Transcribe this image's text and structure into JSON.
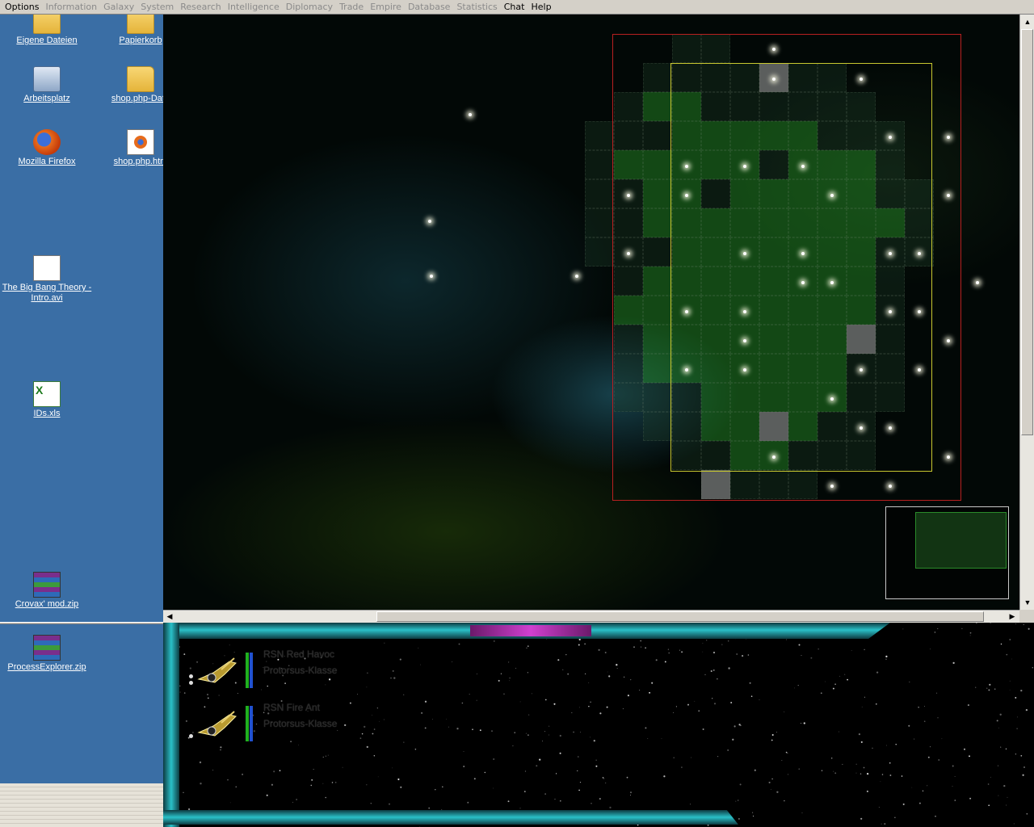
{
  "menu": {
    "items": [
      {
        "label": "Options",
        "enabled": true
      },
      {
        "label": "Information",
        "enabled": false
      },
      {
        "label": "Galaxy",
        "enabled": false
      },
      {
        "label": "System",
        "enabled": false
      },
      {
        "label": "Research",
        "enabled": false
      },
      {
        "label": "Intelligence",
        "enabled": false
      },
      {
        "label": "Diplomacy",
        "enabled": false
      },
      {
        "label": "Trade",
        "enabled": false
      },
      {
        "label": "Empire",
        "enabled": false
      },
      {
        "label": "Database",
        "enabled": false
      },
      {
        "label": "Statistics",
        "enabled": false
      },
      {
        "label": "Chat",
        "enabled": true
      },
      {
        "label": "Help",
        "enabled": true
      }
    ]
  },
  "desktop": {
    "icons": [
      {
        "label": "Eigene Dateien",
        "icon": "folder-icon"
      },
      {
        "label": "Papierkorb",
        "icon": "recycle-bin-icon"
      },
      {
        "label": "Arbeitsplatz",
        "icon": "computer-icon"
      },
      {
        "label": "shop.php-Date",
        "icon": "folder-icon"
      },
      {
        "label": "Mozilla Firefox",
        "icon": "firefox-icon"
      },
      {
        "label": "shop.php.htm",
        "icon": "firefox-document-icon"
      },
      {
        "label": "The Big Bang Theory - Intro.avi",
        "icon": "video-file-icon"
      },
      {
        "label": "IDs.xls",
        "icon": "excel-file-icon"
      },
      {
        "label": "Crovax' mod.zip",
        "icon": "archive-icon"
      },
      {
        "label": "ProcessExplorer.zip",
        "icon": "archive-icon"
      }
    ]
  },
  "fleet": {
    "ships": [
      {
        "name": "RSN Red Havoc",
        "class": "Protorsus-Klasse"
      },
      {
        "name": "RSN Fire Ant",
        "class": "Protorsus-Klasse"
      }
    ]
  },
  "colors": {
    "accent_cyan": "#2ac0c8",
    "accent_magenta": "#d040d0",
    "territory_green": "#289628",
    "border_yellow": "#c8c830",
    "border_red": "#b82020",
    "desktop_blue": "#3a6ea5"
  }
}
